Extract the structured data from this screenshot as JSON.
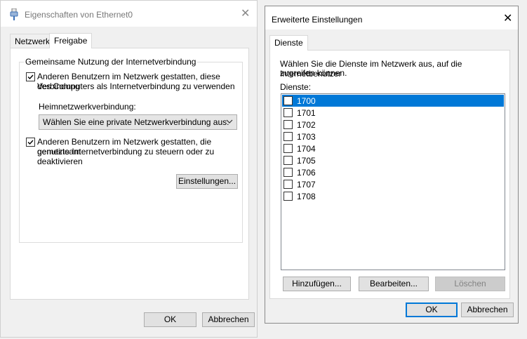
{
  "left_window": {
    "title": "Eigenschaften von Ethernet0",
    "tabs": [
      {
        "label": "Netzwerk",
        "active": false
      },
      {
        "label": "Freigabe",
        "active": true
      }
    ],
    "group_title": "Gemeinsame Nutzung der Internetverbindung",
    "checkbox1": {
      "checked": true,
      "line1": "Anderen Benutzern im Netzwerk gestatten, diese Verbindung",
      "line2": "des Computers als Internetverbindung zu verwenden"
    },
    "home_network_label": "Heimnetzwerkverbindung:",
    "home_network_value": "Wählen Sie eine private Netzwerkverbindung aus.",
    "checkbox2": {
      "checked": true,
      "line1": "Anderen Benutzern im Netzwerk gestatten, die gemeinsam",
      "line2": "genutzte Internetverbindung zu steuern oder zu deaktivieren"
    },
    "settings_button": "Einstellungen...",
    "ok_button": "OK",
    "cancel_button": "Abbrechen"
  },
  "right_window": {
    "title": "Erweiterte Einstellungen",
    "tab": "Dienste",
    "description_line1": "Wählen Sie die Dienste im Netzwerk aus, auf die Internetbenutzer",
    "description_line2": "zugreifen können.",
    "services_label": "Dienste:",
    "services": [
      {
        "name": "1700",
        "checked": false,
        "selected": true
      },
      {
        "name": "1701",
        "checked": false,
        "selected": false
      },
      {
        "name": "1702",
        "checked": false,
        "selected": false
      },
      {
        "name": "1703",
        "checked": false,
        "selected": false
      },
      {
        "name": "1704",
        "checked": false,
        "selected": false
      },
      {
        "name": "1705",
        "checked": false,
        "selected": false
      },
      {
        "name": "1706",
        "checked": false,
        "selected": false
      },
      {
        "name": "1707",
        "checked": false,
        "selected": false
      },
      {
        "name": "1708",
        "checked": false,
        "selected": false
      }
    ],
    "add_button": "Hinzufügen...",
    "edit_button": "Bearbeiten...",
    "delete_button": "Löschen",
    "ok_button": "OK",
    "cancel_button": "Abbrechen"
  },
  "colors": {
    "accent": "#0078d7",
    "selection": "#0078d7",
    "window_bg": "#f0f0f0",
    "panel_bg": "#ffffff",
    "disabled_text": "#838383"
  },
  "icons": {
    "left_title_icon": "network-adapter-icon",
    "close": "close-icon",
    "combo_chevron": "chevron-down-icon",
    "checkmark": "checkmark-icon"
  }
}
